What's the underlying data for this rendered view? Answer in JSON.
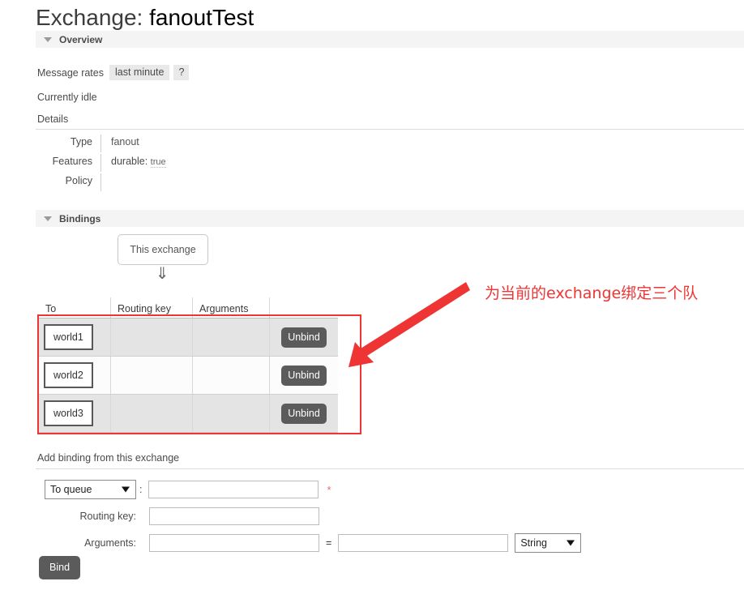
{
  "page": {
    "title_prefix": "Exchange: ",
    "exchange_name": "fanoutTest"
  },
  "overview": {
    "section_label": "Overview",
    "message_rates_label": "Message rates",
    "rate_period_chip": "last minute",
    "help_chip": "?",
    "status_text": "Currently idle",
    "details_label": "Details",
    "details_rows": [
      {
        "key": "Type",
        "value": "fanout"
      },
      {
        "key": "Features",
        "feature_name": "durable:",
        "feature_value": "true"
      },
      {
        "key": "Policy",
        "value": ""
      }
    ]
  },
  "bindings": {
    "section_label": "Bindings",
    "this_exchange_label": "This exchange",
    "down_arrow_glyph": "⇓",
    "columns": [
      "To",
      "Routing key",
      "Arguments",
      ""
    ],
    "rows": [
      {
        "to": "world1",
        "routing_key": "",
        "arguments": "",
        "action": "Unbind"
      },
      {
        "to": "world2",
        "routing_key": "",
        "arguments": "",
        "action": "Unbind"
      },
      {
        "to": "world3",
        "routing_key": "",
        "arguments": "",
        "action": "Unbind"
      }
    ]
  },
  "annotation": {
    "text": "为当前的exchange绑定三个队",
    "color": "#ef3434"
  },
  "add_binding": {
    "title": "Add binding from this exchange",
    "destination_select_value": "To queue",
    "destination_value": "",
    "destination_placeholder": "",
    "required_marker": "*",
    "colon": ":",
    "routing_key_label": "Routing key:",
    "routing_key_value": "",
    "arguments_label": "Arguments:",
    "arguments_key_value": "",
    "equals_sign": "=",
    "arguments_val_value": "",
    "type_select_value": "String",
    "submit_label": "Bind"
  }
}
